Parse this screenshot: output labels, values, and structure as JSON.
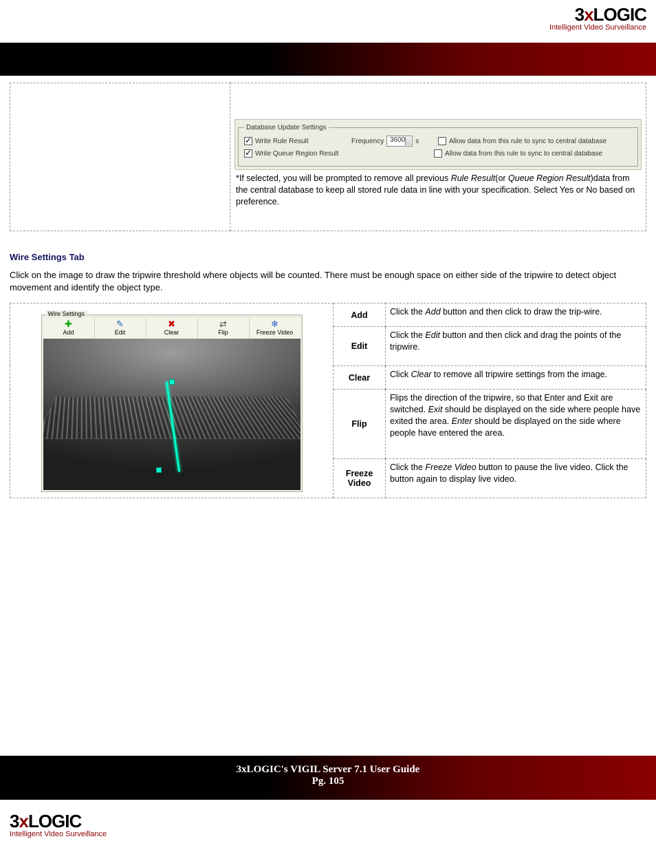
{
  "brand": {
    "logo_prefix": "3",
    "logo_x": "x",
    "logo_suffix": "LOGIC",
    "tagline": "Intelligent Video Surveillance"
  },
  "db_settings": {
    "legend": "Database Update Settings",
    "write_rule_label": "Write Rule Result",
    "write_queue_label": "Write Queue Region Result",
    "frequency_label": "Frequency",
    "frequency_value": "3600",
    "frequency_unit": "s",
    "sync_rule_label": "Allow data from this rule to sync to central database",
    "sync_queue_label": "Allow data from this rule to sync to central database"
  },
  "db_note": {
    "star": "*",
    "p1": "If selected, you will be prompted to remove all previous ",
    "i1": "Rule Result",
    "p2": "(or ",
    "i2": "Queue Region Result",
    "p3": ")data from the central database to keep all stored rule data in line with your specification. Select Yes or No based on preference."
  },
  "section": {
    "heading": "Wire Settings Tab",
    "body": "Click on the image to draw the tripwire threshold where objects will be counted. There must be enough space on either side of the tripwire to detect object movement and identify the object type."
  },
  "wire_shot": {
    "group_label": "Wire Settings",
    "buttons": {
      "add": "Add",
      "edit": "Edit",
      "clear": "Clear",
      "flip": "Flip",
      "freeze": "Freeze Video"
    }
  },
  "wire_rows": {
    "add": {
      "label": "Add",
      "d1": "Click the ",
      "i1": "Add",
      "d2": " button and then click to draw the trip-wire."
    },
    "edit": {
      "label": "Edit",
      "d1": "Click the ",
      "i1": "Edit",
      "d2": " button and then click and drag the points of the tripwire."
    },
    "clear": {
      "label": "Clear",
      "d1": "Click ",
      "i1": "Clear",
      "d2": " to remove all tripwire settings from the image."
    },
    "flip": {
      "label": "Flip",
      "d1": "Flips the direction of the tripwire, so that Enter and Exit are switched. ",
      "i1": "Exit",
      "d2": " should be displayed on the side where people have exited the area. ",
      "i2": "Enter",
      "d3": " should be displayed on the side where people have entered the area."
    },
    "freeze": {
      "label": "Freeze Video",
      "d1": "Click the ",
      "i1": "Freeze Video",
      "d2": " button to pause the live video. Click the button again to display live video."
    }
  },
  "footer": {
    "title": "3xLOGIC's VIGIL Server 7.1 User Guide",
    "page": "Pg. 105"
  }
}
